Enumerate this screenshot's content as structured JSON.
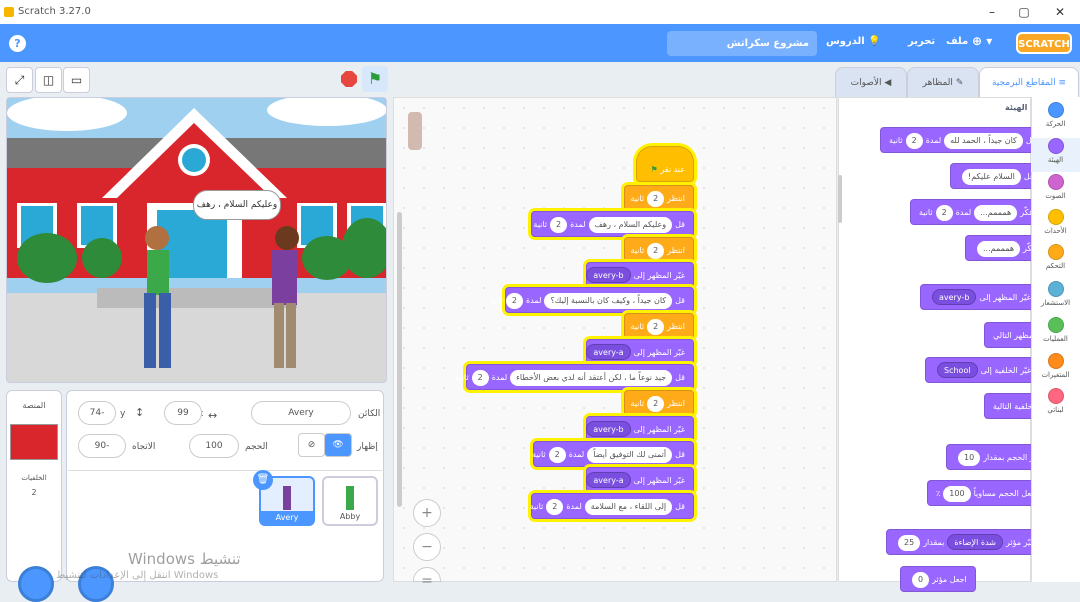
{
  "window": {
    "title": "Scratch 3.27.0",
    "minimize": "–",
    "maximize": "▢",
    "close": "✕"
  },
  "menu": {
    "help": "?",
    "project_name": "مشروع سكراتش",
    "tutorials": "الدروس",
    "edit": "تحرير",
    "file": "ملف",
    "logo": "SCRATCH"
  },
  "controls": {
    "fullscreen": "⤢",
    "green_flag": "⚑"
  },
  "stage": {
    "speech": "وعليكم السلام ، رهف"
  },
  "sprite_info": {
    "name_label": "الكائن",
    "name": "Avery",
    "x_label": "x",
    "x": "99",
    "y_label": "y",
    "y": "74-",
    "show_label": "إظهار",
    "size_label": "الحجم",
    "size": "100",
    "direction_label": "الاتجاه",
    "direction": "90-"
  },
  "stage_panel": {
    "label": "المنصة",
    "backdrops_label": "الخلفيات",
    "backdrops_count": "2"
  },
  "sprites": [
    {
      "name": "Avery"
    },
    {
      "name": "Abby"
    }
  ],
  "tabs": {
    "code": "المقاطع البرمجية",
    "costumes": "المظاهر",
    "sounds": "الأصوات"
  },
  "categories": [
    {
      "label": "الحركة",
      "color": "#4c97ff"
    },
    {
      "label": "الهيئة",
      "color": "#9966ff"
    },
    {
      "label": "الصوت",
      "color": "#cf63cf"
    },
    {
      "label": "الأحداث",
      "color": "#ffbf00"
    },
    {
      "label": "التحكم",
      "color": "#ffab19"
    },
    {
      "label": "الاستشعار",
      "color": "#5cb1d6"
    },
    {
      "label": "العمليات",
      "color": "#59c059"
    },
    {
      "label": "المتغيرات",
      "color": "#ff8c1a"
    },
    {
      "label": "لبناتي",
      "color": "#ff6680"
    }
  ],
  "palette": {
    "heading": "الهيئة",
    "blocks": [
      {
        "text": "قل",
        "arg": "كان جيداً ، الحمد لله",
        "dur_label": "لمدة",
        "dur": "2",
        "unit": "ثانية"
      },
      {
        "text": "قل",
        "arg": "السلام عليكم!"
      },
      {
        "text": "فكّر",
        "arg": "همممم...",
        "dur_label": "لمدة",
        "dur": "2",
        "unit": "ثانية"
      },
      {
        "text": "فكّر",
        "arg": "همممم..."
      },
      {
        "text": "غيّر المظهر إلى",
        "arg": "avery-b"
      },
      {
        "text": "المظهر التالي"
      },
      {
        "text": "غيّر الخلفية إلى",
        "arg": "School"
      },
      {
        "text": "الخلفية التالية"
      },
      {
        "text": "غيّر الحجم بمقدار",
        "arg": "10"
      },
      {
        "text": "اجعل الحجم مساوياً",
        "arg": "100",
        "suffix": "٪"
      },
      {
        "text": "غيّر مؤثر",
        "arg": "شدة الإضاءة",
        "by_label": "بمقدار",
        "val": "25"
      },
      {
        "text": "اجعل مؤثر",
        "val": "0"
      }
    ]
  },
  "script": {
    "hat": "عند نقر",
    "wait_label": "انتظر",
    "sec": "ثانية",
    "say": "قل",
    "for_label": "لمدة",
    "switch": "غيّر المظهر إلى",
    "blocks": [
      {
        "kind": "wait",
        "val": "2"
      },
      {
        "kind": "say",
        "msg": "وعليكم السلام ، رهف",
        "dur": "2"
      },
      {
        "kind": "wait",
        "val": "2"
      },
      {
        "kind": "switch",
        "costume": "avery-b"
      },
      {
        "kind": "say",
        "msg": "كان جيداً ، وكيف كان بالنسبة إليك؟",
        "dur": "2"
      },
      {
        "kind": "wait",
        "val": "2"
      },
      {
        "kind": "switch",
        "costume": "avery-a"
      },
      {
        "kind": "say",
        "msg": "جيد نوعاً ما ، لكن أعتقد أنه لدي بعض الأخطاء",
        "dur": "2"
      },
      {
        "kind": "wait",
        "val": "2"
      },
      {
        "kind": "switch",
        "costume": "avery-b"
      },
      {
        "kind": "say",
        "msg": "أتمنى لك التوفيق أيضاً",
        "dur": "2"
      },
      {
        "kind": "switch",
        "costume": "avery-a"
      },
      {
        "kind": "say",
        "msg": "إلى اللقاء ، مع السلامة",
        "dur": "2"
      }
    ]
  },
  "zoom": {
    "in": "+",
    "out": "−",
    "reset": "="
  },
  "watermark": {
    "line1": "Windows تنشيط",
    "line2": "انتقل إلى الإعدادات لتنشيط Windows"
  }
}
